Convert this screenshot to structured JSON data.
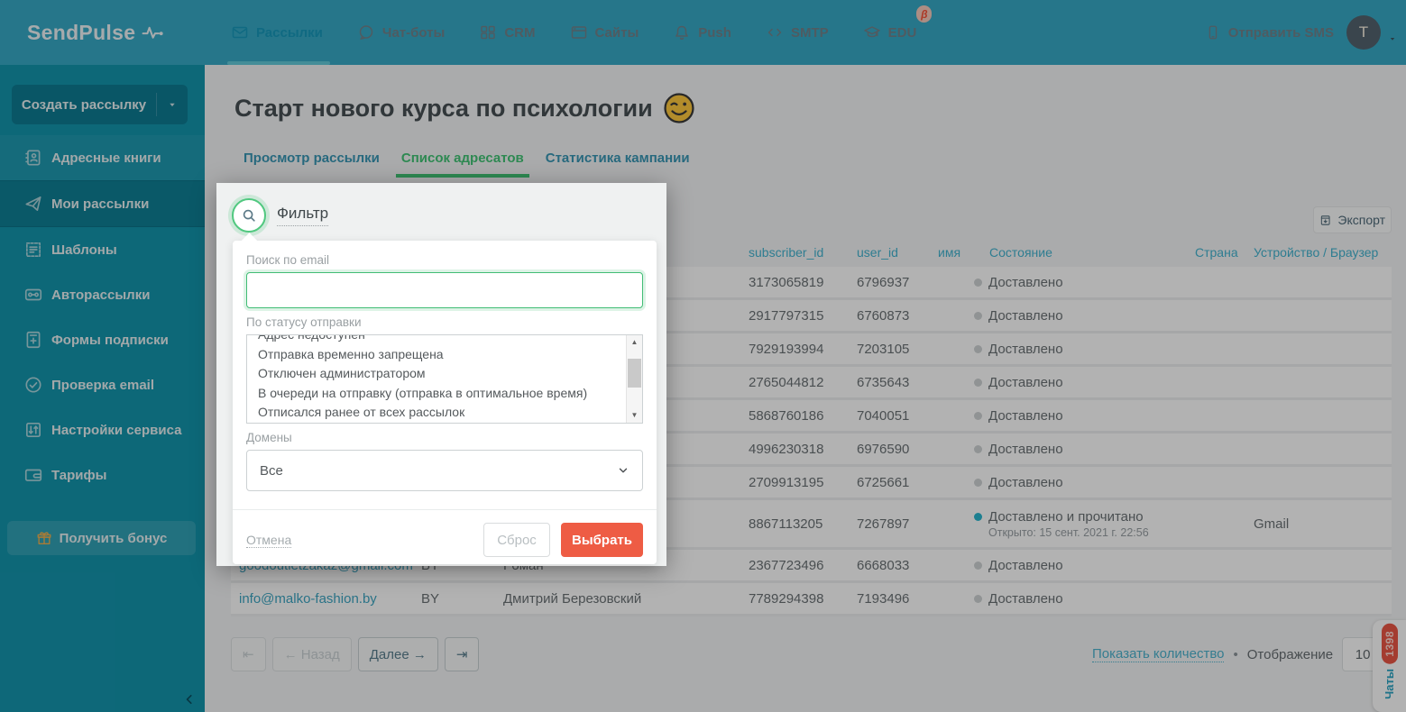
{
  "brand": {
    "logo_text": "SendPulse"
  },
  "topnav": {
    "items": [
      {
        "label": "Рассылки",
        "icon": "envelope",
        "active": true
      },
      {
        "label": "Чат-боты",
        "icon": "chat",
        "active": false
      },
      {
        "label": "CRM",
        "icon": "crm",
        "active": false
      },
      {
        "label": "Сайты",
        "icon": "sites",
        "active": false
      },
      {
        "label": "Push",
        "icon": "bell",
        "active": false
      },
      {
        "label": "SMTP",
        "icon": "code",
        "active": false
      },
      {
        "label": "EDU",
        "icon": "edu",
        "active": false,
        "beta": true
      }
    ],
    "beta_badge": "β",
    "send_sms_label": "Отправить SMS",
    "avatar_initial": "T"
  },
  "sidebar": {
    "create_button_label": "Создать рассылку",
    "items": [
      {
        "label": "Адресные книги",
        "icon": "addressbook",
        "tint": true,
        "active": false
      },
      {
        "label": "Мои рассылки",
        "icon": "plane",
        "active": true
      },
      {
        "label": "Шаблоны",
        "icon": "template",
        "active": false
      },
      {
        "label": "Авторассылки",
        "icon": "auto",
        "active": false
      },
      {
        "label": "Формы подписки",
        "icon": "form",
        "active": false
      },
      {
        "label": "Проверка email",
        "icon": "check",
        "active": false
      },
      {
        "label": "Настройки сервиса",
        "icon": "sliders",
        "active": false
      },
      {
        "label": "Тарифы",
        "icon": "wallet",
        "active": false
      }
    ],
    "bonus_label": "Получить бонус"
  },
  "page": {
    "title": "Старт нового курса по психологии",
    "title_emoji": "wink-emoji",
    "tabs": [
      {
        "label": "Просмотр рассылки",
        "active": false
      },
      {
        "label": "Список адресатов",
        "active": true
      },
      {
        "label": "Статистика кампании",
        "active": false
      }
    ],
    "export_label": "Экспорт"
  },
  "table": {
    "headers": [
      {
        "label": "subscriber_id",
        "key": "sub"
      },
      {
        "label": "user_id",
        "key": "user"
      },
      {
        "label": "имя",
        "key": "imya"
      },
      {
        "label": "Состояние",
        "key": "status"
      },
      {
        "label": "Страна",
        "key": "country"
      },
      {
        "label": "Устройство / Браузер",
        "key": "device"
      }
    ],
    "rows": [
      {
        "email": "",
        "lang": "",
        "name": "",
        "subscriber_id": "3173065819",
        "user_id": "6796937",
        "status": "Доставлено",
        "status_dot": "gray",
        "status_sub": "",
        "device": ""
      },
      {
        "email": "",
        "lang": "",
        "name": "",
        "subscriber_id": "2917797315",
        "user_id": "6760873",
        "status": "Доставлено",
        "status_dot": "gray",
        "status_sub": "",
        "device": ""
      },
      {
        "email": "",
        "lang": "",
        "name": "",
        "subscriber_id": "7929193994",
        "user_id": "7203105",
        "status": "Доставлено",
        "status_dot": "gray",
        "status_sub": "",
        "device": ""
      },
      {
        "email": "",
        "lang": "",
        "name": "",
        "subscriber_id": "2765044812",
        "user_id": "6735643",
        "status": "Доставлено",
        "status_dot": "gray",
        "status_sub": "",
        "device": ""
      },
      {
        "email": "",
        "lang": "",
        "name": "",
        "subscriber_id": "5868760186",
        "user_id": "7040051",
        "status": "Доставлено",
        "status_dot": "gray",
        "status_sub": "",
        "device": ""
      },
      {
        "email": "",
        "lang": "",
        "name": "",
        "subscriber_id": "4996230318",
        "user_id": "6976590",
        "status": "Доставлено",
        "status_dot": "gray",
        "status_sub": "",
        "device": ""
      },
      {
        "email": "",
        "lang": "",
        "name": "",
        "subscriber_id": "2709913195",
        "user_id": "6725661",
        "status": "Доставлено",
        "status_dot": "gray",
        "status_sub": "",
        "device": ""
      },
      {
        "email": "",
        "lang": "",
        "name": "",
        "subscriber_id": "8867113205",
        "user_id": "7267897",
        "status": "Доставлено и прочитано",
        "status_dot": "teal",
        "status_sub": "Открыто: 15 сент. 2021 г. 22:56",
        "device": "Gmail",
        "tall": true
      },
      {
        "email": "goodoutletzakaz@gmail.com",
        "lang": "BY",
        "name": "Роман",
        "subscriber_id": "2367723496",
        "user_id": "6668033",
        "status": "Доставлено",
        "status_dot": "gray",
        "status_sub": "",
        "device": ""
      },
      {
        "email": "info@malko-fashion.by",
        "lang": "BY",
        "name": "Дмитрий Березовский",
        "subscriber_id": "7789294398",
        "user_id": "7193496",
        "status": "Доставлено",
        "status_dot": "gray",
        "status_sub": "",
        "device": ""
      }
    ]
  },
  "pagination": {
    "buttons": [
      {
        "label": "⇤",
        "enabled": false,
        "name": "first-page-button"
      },
      {
        "label": "← Назад",
        "enabled": false,
        "name": "prev-page-button"
      },
      {
        "label": "Далее →",
        "enabled": true,
        "name": "next-page-button"
      },
      {
        "label": "⇥",
        "enabled": true,
        "name": "last-page-button"
      }
    ],
    "show_count_label": "Показать количество",
    "bullet": "•",
    "display_label": "Отображение",
    "page_size": "10"
  },
  "chat_widget": {
    "badge_count": "1398",
    "label": "Чаты"
  },
  "filter_modal": {
    "title": "Фильтр",
    "email_label": "Поиск по email",
    "email_value": "",
    "status_label": "По статусу отправки",
    "status_options": [
      "Адрес недоступен",
      "Отправка временно запрещена",
      "Отключен администратором",
      "В очереди на отправку (отправка в оптимальное время)",
      "Отписался ранее от всех рассылок"
    ],
    "domains_label": "Домены",
    "domains_value": "Все",
    "cancel_label": "Отмена",
    "reset_label": "Сброс",
    "apply_label": "Выбрать"
  },
  "colors": {
    "header_teal": "#37aac6",
    "sidebar_teal": "#1495ad",
    "accent_green": "#42c576",
    "link_teal": "#43b3d0",
    "apply_orange": "#ee5c44",
    "chat_badge_red": "#eb5745"
  }
}
